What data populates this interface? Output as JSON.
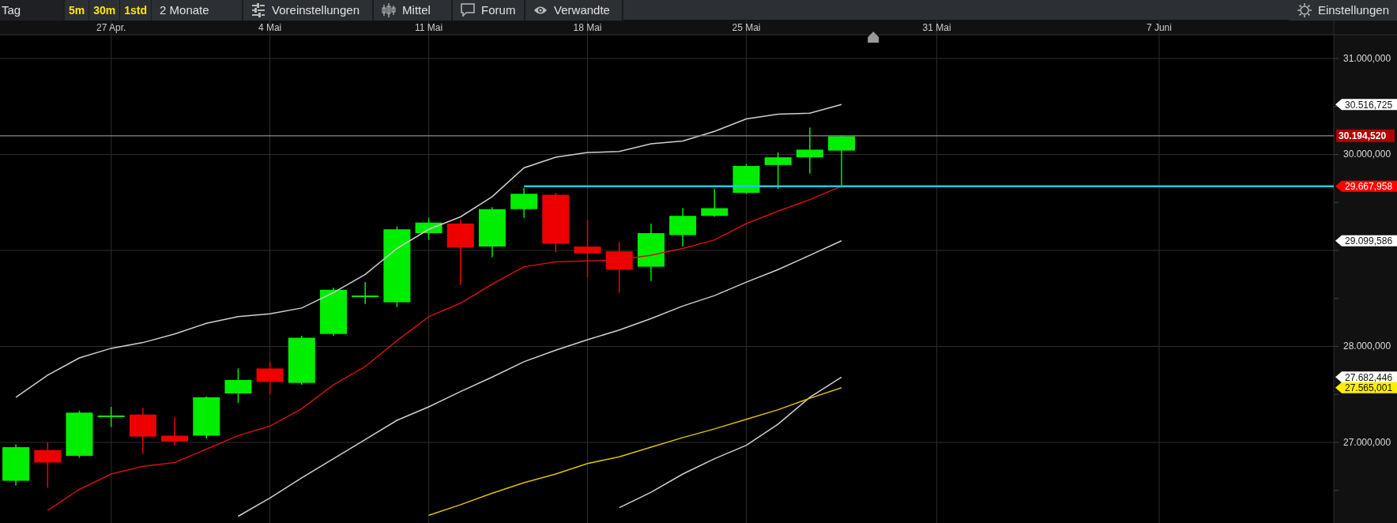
{
  "toolbar": {
    "period": "Tag",
    "intervals": [
      {
        "label": "5m"
      },
      {
        "label": "30m"
      },
      {
        "label": "1std"
      }
    ],
    "range": "2 Monate",
    "buttons": [
      {
        "label": "Voreinstellungen",
        "kind": "presets"
      },
      {
        "label": "Mittel",
        "kind": "indicators"
      },
      {
        "label": "Forum",
        "kind": "forum"
      },
      {
        "label": "Verwandte",
        "kind": "related"
      }
    ],
    "settings": "Einstellungen"
  },
  "chart": {
    "chart_data": {
      "type": "line",
      "grid": true,
      "ylim": [
        26160,
        31247
      ],
      "categories": [
        null,
        null,
        null,
        "27 Apr.",
        null,
        null,
        null,
        null,
        "4 Mai",
        null,
        null,
        null,
        null,
        "11 Mai",
        null,
        null,
        null,
        null,
        "18 Mai",
        null,
        null,
        null,
        null,
        "25 Mai",
        null,
        null,
        null,
        null,
        null,
        "31 Mai",
        null,
        null,
        null,
        null,
        null,
        null,
        "7 Juni",
        null,
        null,
        null,
        null,
        null
      ],
      "yticks": [
        {
          "value": 31000,
          "label": "31.000,000"
        },
        {
          "value": 30000,
          "label": "30.000,000"
        },
        {
          "value": 28000,
          "label": "28.000,000"
        },
        {
          "value": 27000,
          "label": "27.000,000"
        }
      ],
      "series": [
        {
          "color": "#d0d0d0",
          "values": [
            27470,
            27700,
            27880,
            27980,
            28040,
            28130,
            28240,
            28310,
            28340,
            28400,
            28560,
            28750,
            29020,
            29220,
            29350,
            29560,
            29860,
            29970,
            30020,
            30030,
            30110,
            30140,
            30240,
            30370,
            30420,
            30430,
            30520,
            null,
            null,
            null,
            null,
            null,
            null,
            null,
            null,
            null,
            null,
            null,
            null,
            null,
            null,
            null
          ]
        },
        {
          "color": "#d0d0d0",
          "values": [
            null,
            null,
            null,
            null,
            null,
            null,
            null,
            26230,
            26420,
            26630,
            26830,
            27030,
            27230,
            27370,
            27530,
            27680,
            27840,
            27960,
            28070,
            28170,
            28290,
            28420,
            28530,
            28670,
            28800,
            28950,
            29100,
            null,
            null,
            null,
            null,
            null,
            null,
            null,
            null,
            null,
            null,
            null,
            null,
            null,
            null,
            null
          ]
        },
        {
          "color": "#d0d0d0",
          "values": [
            null,
            null,
            null,
            null,
            null,
            null,
            null,
            null,
            null,
            null,
            null,
            null,
            null,
            null,
            null,
            null,
            null,
            null,
            null,
            26320,
            26480,
            26670,
            26830,
            26970,
            27190,
            27470,
            27680,
            null,
            null,
            null,
            null,
            null,
            null,
            null,
            null,
            null,
            null,
            null,
            null,
            null,
            null,
            null
          ]
        },
        {
          "color": "#d8c400",
          "values": [
            null,
            null,
            null,
            null,
            null,
            null,
            null,
            null,
            null,
            null,
            null,
            null,
            null,
            26240,
            26350,
            26470,
            26580,
            26670,
            26780,
            26850,
            26950,
            27050,
            27140,
            27240,
            27340,
            27460,
            27570,
            null,
            null,
            null,
            null,
            null,
            null,
            null,
            null,
            null,
            null,
            null,
            null,
            null,
            null,
            null
          ]
        },
        {
          "color": "#d01010",
          "values": [
            null,
            26290,
            26510,
            26670,
            26750,
            26790,
            26930,
            27070,
            27170,
            27350,
            27600,
            27790,
            28060,
            28310,
            28450,
            28650,
            28830,
            28880,
            28890,
            28900,
            28950,
            29020,
            29110,
            29280,
            29410,
            29530,
            29670,
            null,
            null,
            null,
            null,
            null,
            null,
            null,
            null,
            null,
            null,
            null,
            null,
            null,
            null,
            null
          ]
        }
      ],
      "ref_lines": [
        {
          "axis": "y",
          "value": 30194.52,
          "label": "30.194,520",
          "color": "#8c8c8c"
        },
        {
          "axis": "y",
          "value": 29667.958,
          "label": "29.667,958",
          "color": "#1ec8e6"
        }
      ],
      "annotations": [
        "30.516,725",
        "29.099,586",
        "27.682,446",
        "27.565,001"
      ]
    }
  }
}
